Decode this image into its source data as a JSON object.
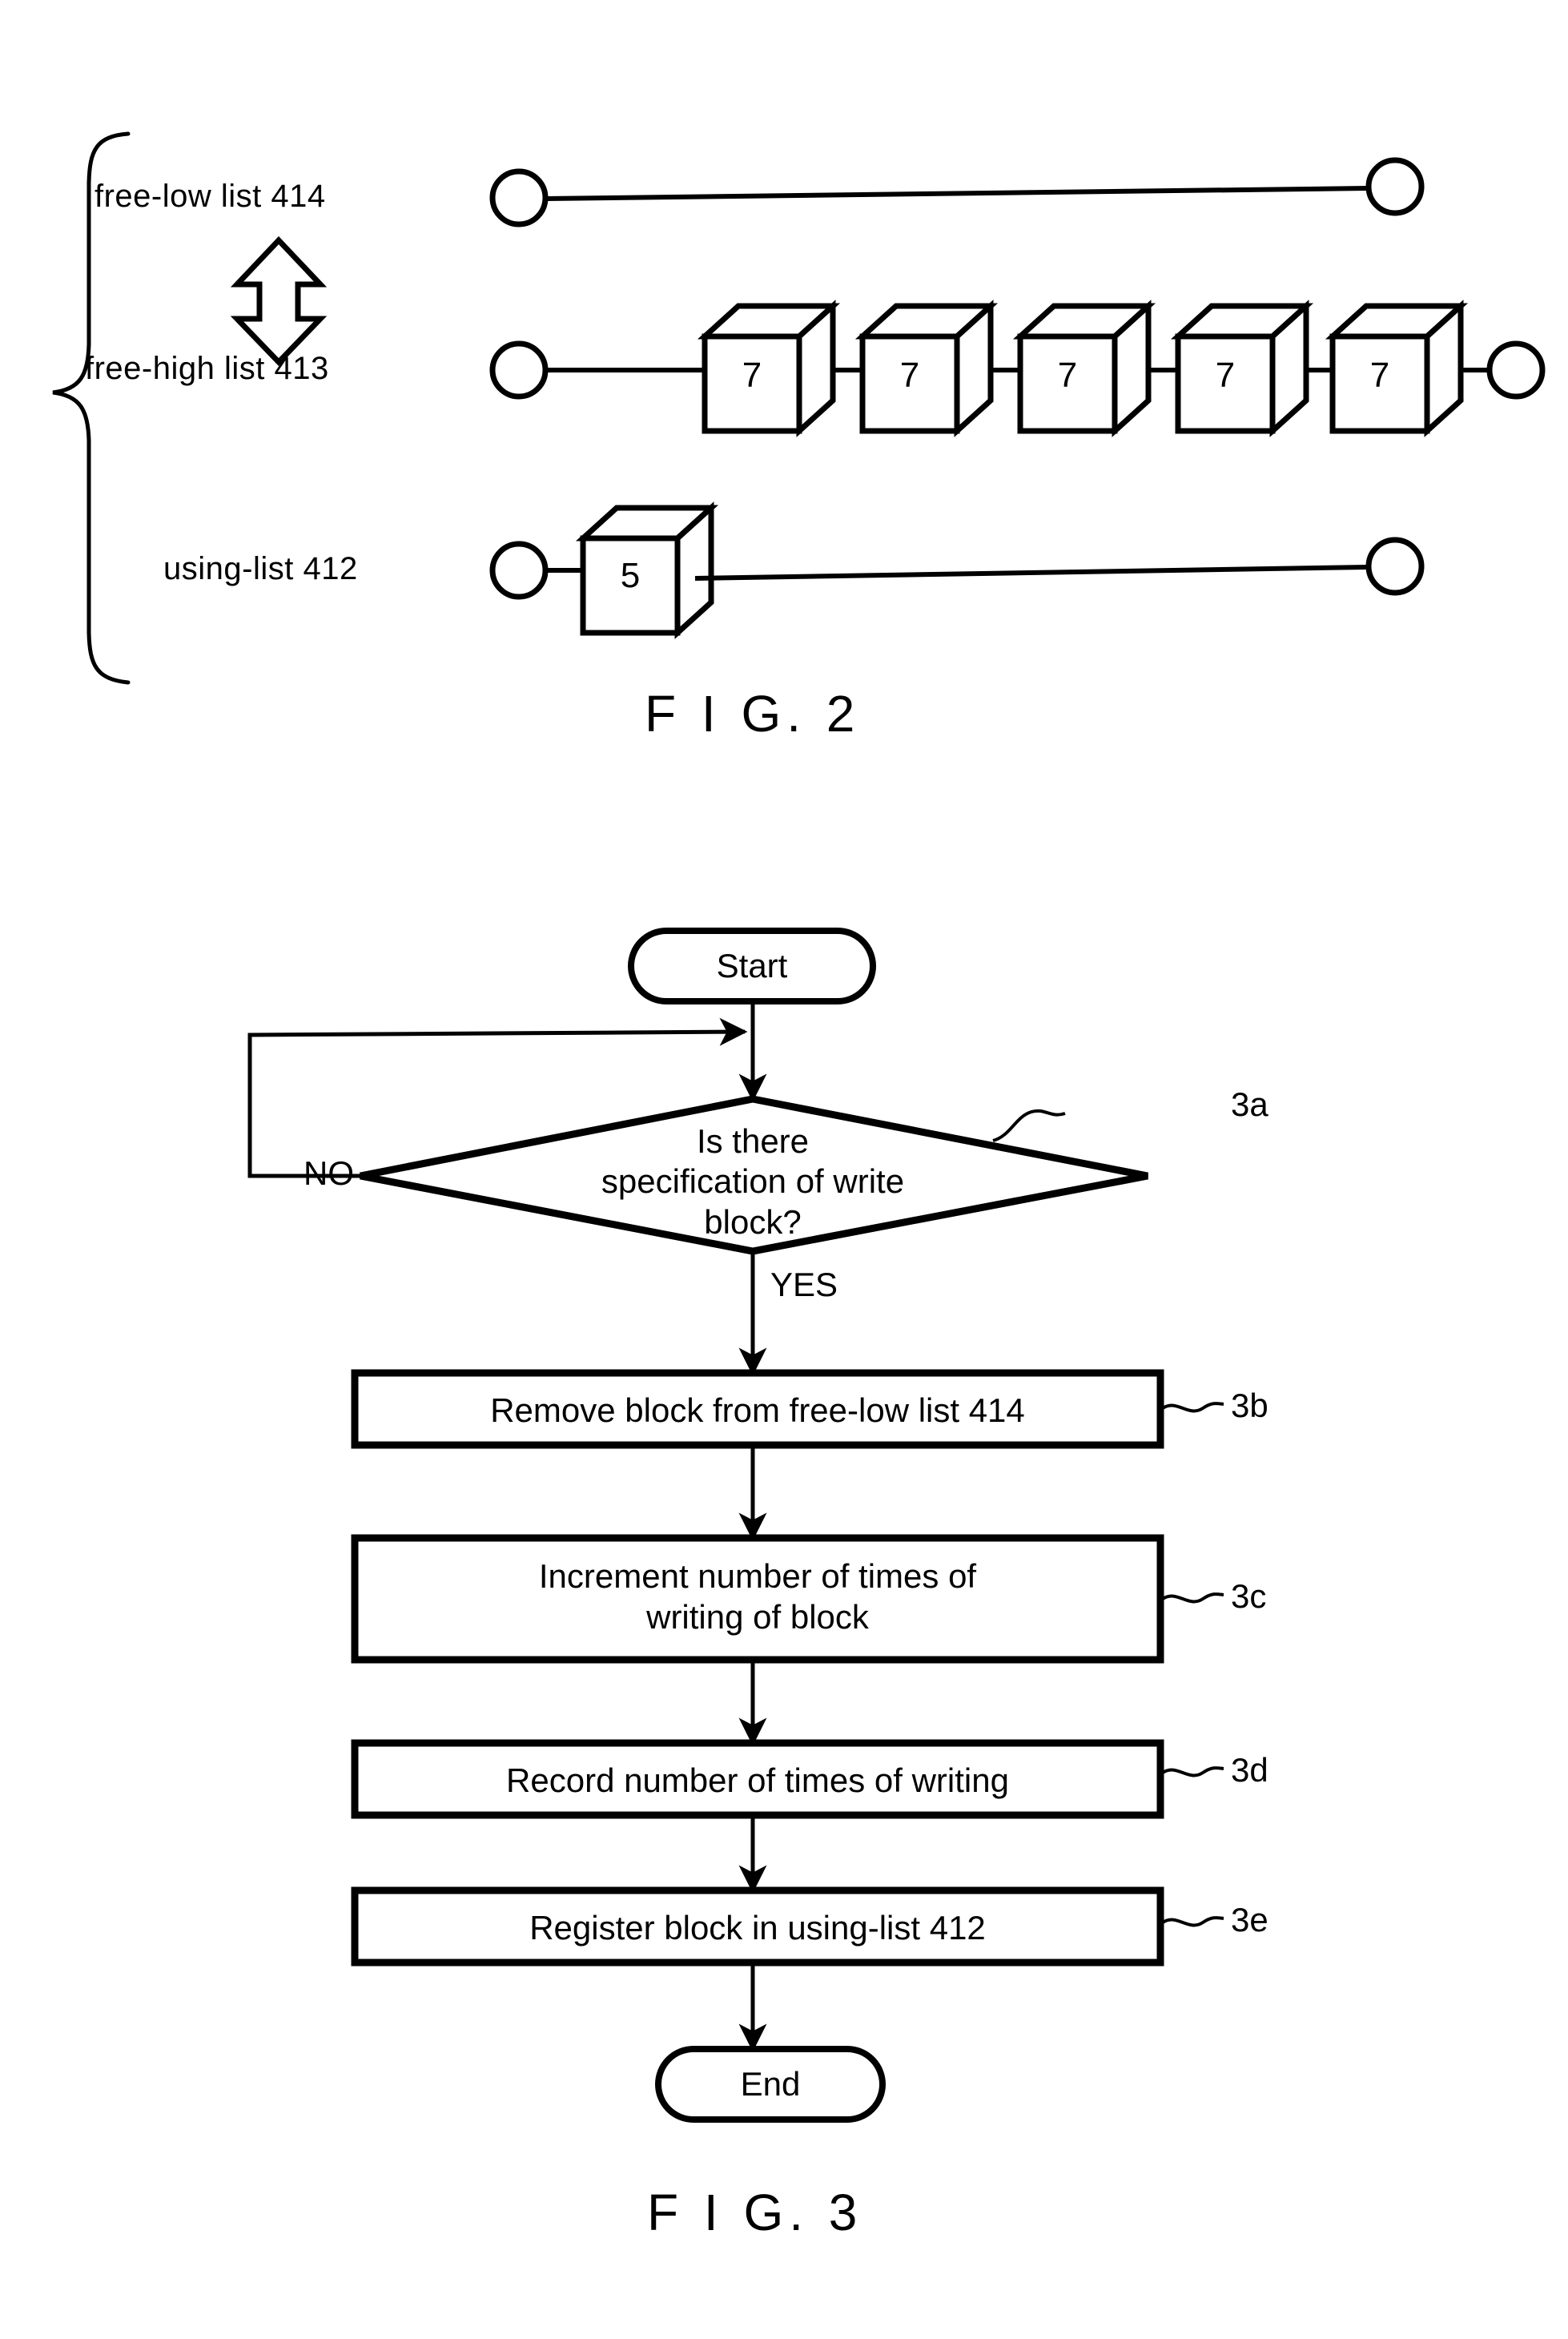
{
  "figure2": {
    "caption": "F I G. 2",
    "rows": [
      {
        "label": "free-low  list 414",
        "name": "free-low-list",
        "blocks": [],
        "has_tail_circle": true
      },
      {
        "label": "free-high  list 413",
        "name": "free-high-list",
        "blocks": [
          "7",
          "7",
          "7",
          "7",
          "7"
        ],
        "has_tail_circle": true
      },
      {
        "label": "using-list 412",
        "name": "using-list",
        "blocks": [
          "5"
        ],
        "has_tail_circle": true
      }
    ],
    "exchange_arrow": "double-headed-vertical-arrow",
    "brace": "left-curly-brace"
  },
  "figure3": {
    "caption": "F I G. 3",
    "start_label": "Start",
    "end_label": "End",
    "decision": {
      "ref": "3a",
      "lines": [
        "Is there",
        "specification of write",
        "block?"
      ],
      "yes_label": "YES",
      "no_label": "NO"
    },
    "steps": [
      {
        "ref": "3b",
        "lines": [
          "Remove block from free-low list 414"
        ]
      },
      {
        "ref": "3c",
        "lines": [
          "Increment number of times of",
          "writing of block"
        ]
      },
      {
        "ref": "3d",
        "lines": [
          "Record number of times of writing"
        ]
      },
      {
        "ref": "3e",
        "lines": [
          "Register block in using-list 412"
        ]
      }
    ]
  },
  "colors": {
    "ink": "#000000",
    "paper": "#ffffff"
  }
}
